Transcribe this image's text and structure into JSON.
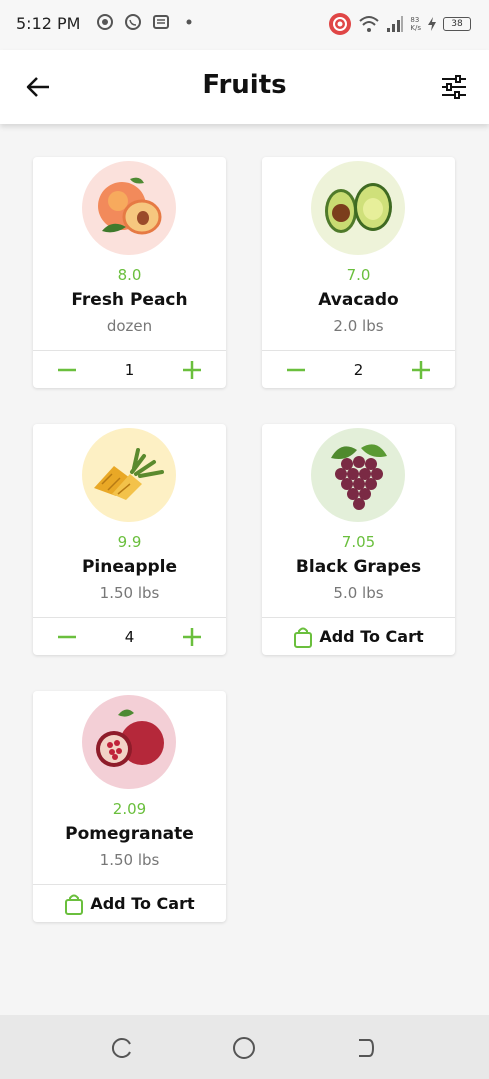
{
  "status_bar": {
    "time": "5:12 PM",
    "battery": "38",
    "net_speed_top": "83",
    "net_speed_bottom": "K/s"
  },
  "app_bar": {
    "title": "Fruits"
  },
  "products": [
    {
      "price": "8.0",
      "name": "Fresh Peach",
      "unit": "dozen",
      "quantity": "1",
      "in_cart": true
    },
    {
      "price": "7.0",
      "name": "Avacado",
      "unit": "2.0 lbs",
      "quantity": "2",
      "in_cart": true
    },
    {
      "price": "9.9",
      "name": "Pineapple",
      "unit": "1.50 lbs",
      "quantity": "4",
      "in_cart": true
    },
    {
      "price": "7.05",
      "name": "Black Grapes",
      "unit": "5.0 lbs",
      "add_label": "Add To Cart",
      "in_cart": false
    },
    {
      "price": "2.09",
      "name": "Pomegranate",
      "unit": "1.50 lbs",
      "add_label": "Add To Cart",
      "in_cart": false
    }
  ],
  "colors": {
    "accent": "#6abf3d",
    "background": "#f5f5f5"
  },
  "icons": {
    "back": "arrow-left-icon",
    "filter": "sliders-icon",
    "minus": "minus-icon",
    "plus": "plus-icon",
    "cart": "shopping-bag-icon"
  }
}
